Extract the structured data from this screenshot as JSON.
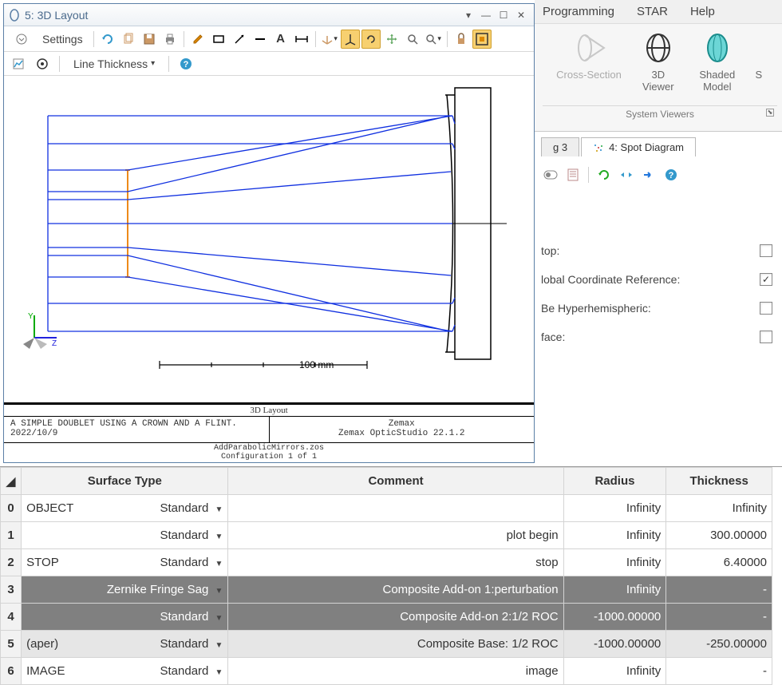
{
  "ribbon": {
    "menus": [
      "Programming",
      "STAR",
      "Help"
    ],
    "items": [
      {
        "label": "Cross-Section",
        "disabled": true
      },
      {
        "label": "3D\nViewer"
      },
      {
        "label": "Shaded\nModel"
      }
    ],
    "group_label": "System Viewers",
    "cut_item": "S"
  },
  "win3d": {
    "title": "5: 3D Layout",
    "settings_label": "Settings",
    "line_thickness_label": "Line Thickness",
    "layout_label": "3D Layout",
    "description_line1": "A SIMPLE DOUBLET USING A CROWN AND A FLINT.",
    "description_line2": "2022/10/9",
    "brand": "Zemax",
    "product": "Zemax OpticStudio 22.1.2",
    "file": "AddParabolicMirrors.zos",
    "config": "Configuration 1 of 1",
    "scale_label": "100 mm"
  },
  "tabs": {
    "partial_left": "g 3",
    "spot": "4: Spot Diagram"
  },
  "props": {
    "rows": [
      {
        "label": "top:",
        "checked": false
      },
      {
        "label": "lobal Coordinate Reference:",
        "checked": true
      },
      {
        "label": "Be Hyperhemispheric:",
        "checked": false
      },
      {
        "label": "face:",
        "checked": false
      }
    ]
  },
  "table": {
    "headers": [
      "",
      "Surface Type",
      "Comment",
      "Radius",
      "Thickness"
    ],
    "rows": [
      {
        "idx": "0",
        "name": "OBJECT",
        "type": "Standard",
        "comment": "",
        "radius": "Infinity",
        "thk": "Infinity",
        "cls": ""
      },
      {
        "idx": "1",
        "name": "",
        "type": "Standard",
        "comment": "plot begin",
        "radius": "Infinity",
        "thk": "300.00000",
        "cls": ""
      },
      {
        "idx": "2",
        "name": "STOP",
        "type": "Standard",
        "comment": "stop",
        "radius": "Infinity",
        "thk": "6.40000",
        "cls": ""
      },
      {
        "idx": "3",
        "name": "",
        "type": "Zernike Fringe Sag",
        "comment": "Composite Add-on 1:perturbation",
        "radius": "Infinity",
        "thk": "-",
        "cls": "dark"
      },
      {
        "idx": "4",
        "name": "",
        "type": "Standard",
        "comment": "Composite Add-on 2:1/2 ROC",
        "radius": "-1000.00000",
        "thk": "-",
        "cls": "dark"
      },
      {
        "idx": "5",
        "name": "(aper)",
        "type": "Standard",
        "comment": "Composite Base: 1/2 ROC",
        "radius": "-1000.00000",
        "thk": "-250.00000",
        "cls": "light"
      },
      {
        "idx": "6",
        "name": "IMAGE",
        "type": "Standard",
        "comment": "image",
        "radius": "Infinity",
        "thk": "-",
        "cls": ""
      }
    ]
  }
}
